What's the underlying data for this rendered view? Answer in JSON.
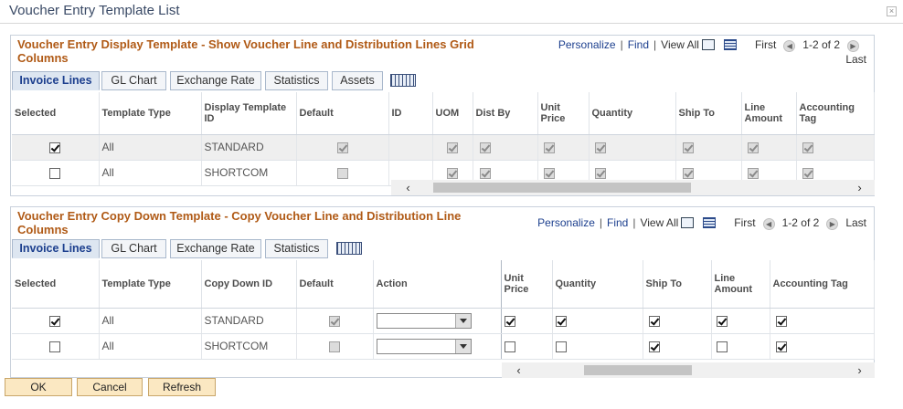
{
  "window": {
    "title": "Voucher Entry Template List",
    "close_label": "×"
  },
  "display_grid": {
    "title_line1": "Voucher Entry Display Template - Show Voucher Line and Distribution Lines Grid",
    "title_line2": "Columns",
    "nav": {
      "personalize": "Personalize",
      "find": "Find",
      "view_all": "View All",
      "first": "First",
      "range": "1-2 of 2",
      "last": "Last"
    },
    "tabs": [
      "Invoice Lines",
      "GL Chart",
      "Exchange Rate",
      "Statistics",
      "Assets"
    ],
    "columns": [
      "Selected",
      "Template Type",
      "Display Template ID",
      "Default",
      "ID",
      "UOM",
      "Dist By",
      "Unit Price",
      "Quantity",
      "Ship To",
      "Line Amount",
      "Accounting Tag"
    ],
    "rows": [
      {
        "selected": true,
        "template_type": "All",
        "template_id": "STANDARD",
        "default": true,
        "flags": [
          true,
          true,
          true,
          true,
          true,
          true,
          true
        ]
      },
      {
        "selected": false,
        "template_type": "All",
        "template_id": "SHORTCOM",
        "default": false,
        "flags": [
          true,
          true,
          true,
          true,
          true,
          true,
          true
        ]
      }
    ]
  },
  "copy_grid": {
    "title_line1": "Voucher Entry Copy Down Template - Copy Voucher Line and Distribution Line",
    "title_line2": "Columns",
    "nav": {
      "personalize": "Personalize",
      "find": "Find",
      "view_all": "View All",
      "first": "First",
      "range": "1-2 of 2",
      "last": "Last"
    },
    "tabs": [
      "Invoice Lines",
      "GL Chart",
      "Exchange Rate",
      "Statistics"
    ],
    "columns": [
      "Selected",
      "Template Type",
      "Copy Down ID",
      "Default",
      "Action",
      "Unit Price",
      "Quantity",
      "Ship To",
      "Line Amount",
      "Accounting Tag"
    ],
    "rows": [
      {
        "selected": true,
        "template_type": "All",
        "copy_id": "STANDARD",
        "default": true,
        "action": "",
        "unit_price": true,
        "quantity": true,
        "ship_to": true,
        "line_amount": true,
        "accounting_tag": true
      },
      {
        "selected": false,
        "template_type": "All",
        "copy_id": "SHORTCOM",
        "default": false,
        "action": "",
        "unit_price": false,
        "quantity": false,
        "ship_to": true,
        "line_amount": false,
        "accounting_tag": true
      }
    ]
  },
  "buttons": {
    "ok": "OK",
    "cancel": "Cancel",
    "refresh": "Refresh"
  },
  "colors": {
    "group_title": "#b05a16",
    "link": "#1c3f8e",
    "button_bg": "#fbe8c2"
  }
}
